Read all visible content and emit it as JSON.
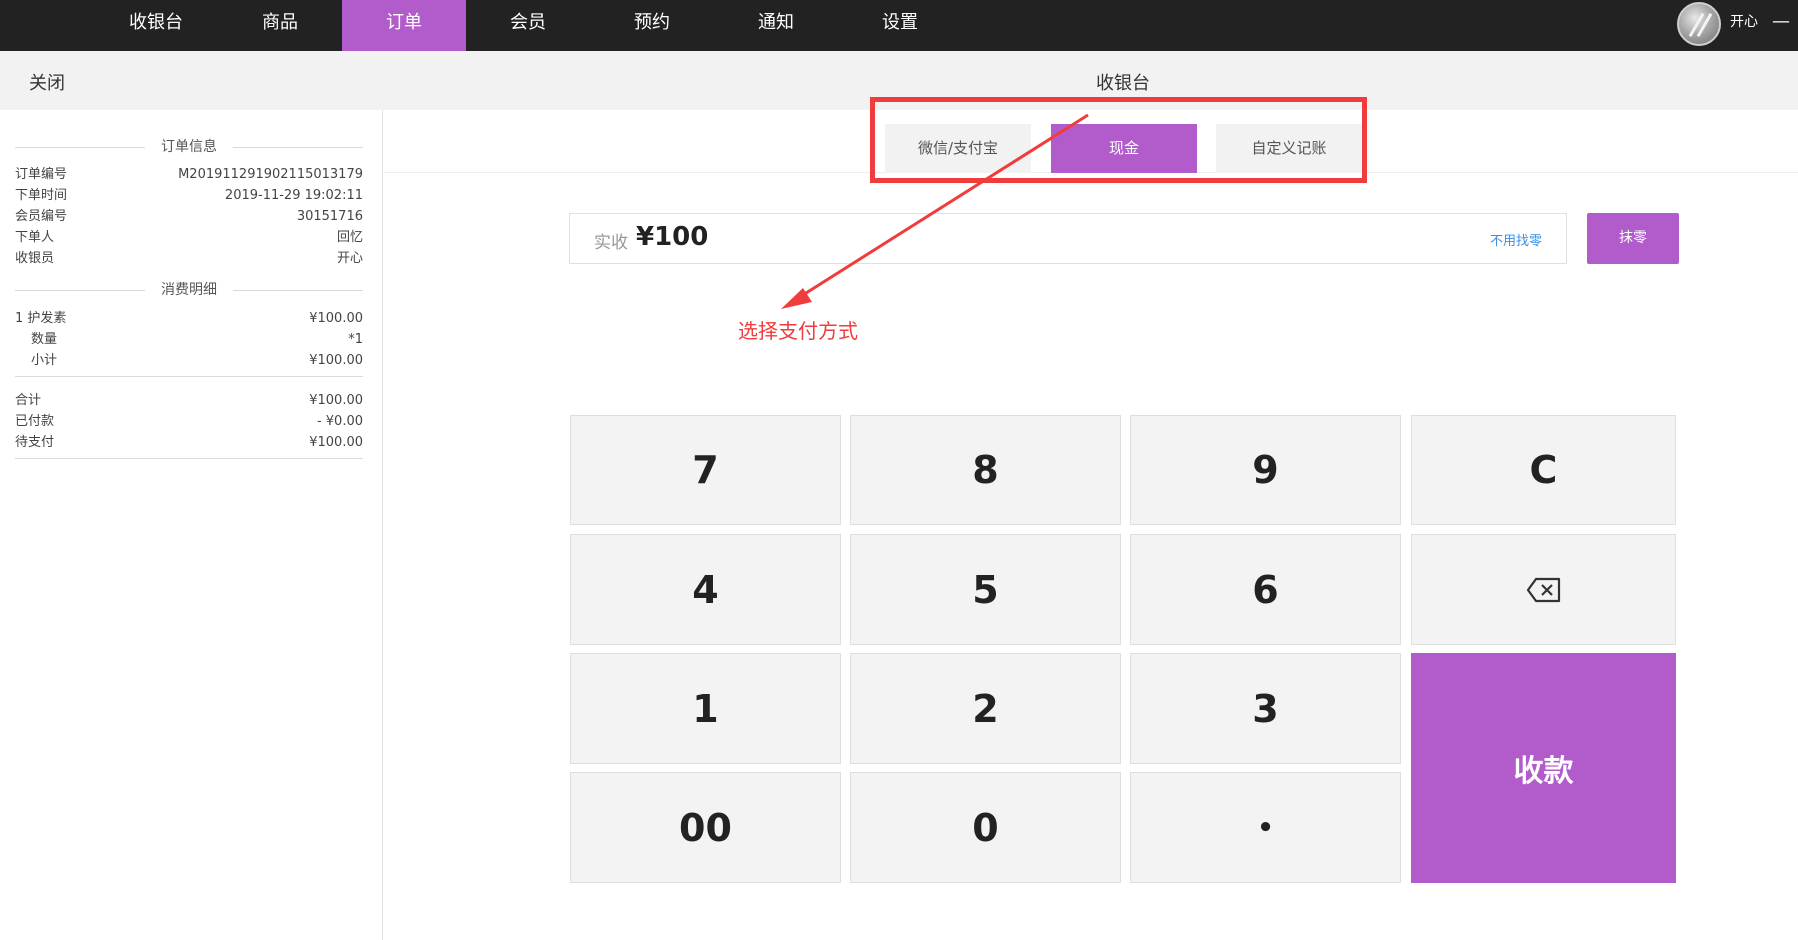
{
  "nav": {
    "items": [
      {
        "label": "收银台",
        "active": false
      },
      {
        "label": "商品",
        "active": false
      },
      {
        "label": "订单",
        "active": true
      },
      {
        "label": "会员",
        "active": false
      },
      {
        "label": "预约",
        "active": false
      },
      {
        "label": "通知",
        "active": false
      },
      {
        "label": "设置",
        "active": false
      }
    ],
    "username": "开心",
    "collapse_symbol": "—",
    "avatar_icon": "avatar-icon"
  },
  "subheader": {
    "close_label": "关闭",
    "title": "收银台"
  },
  "order_info": {
    "section_title": "订单信息",
    "rows": [
      {
        "key": "订单编号",
        "value": "M201911291902115013179"
      },
      {
        "key": "下单时间",
        "value": "2019-11-29 19:02:11"
      },
      {
        "key": "会员编号",
        "value": "30151716"
      },
      {
        "key": "下单人",
        "value": "回忆"
      },
      {
        "key": "收银员",
        "value": "开心"
      }
    ]
  },
  "consumption": {
    "section_title": "消费明细",
    "item": {
      "index_name": "1  护发素",
      "price": "¥100.00"
    },
    "qty": {
      "key": "数量",
      "value": "*1"
    },
    "subtotal": {
      "key": "小计",
      "value": "¥100.00"
    },
    "totals": [
      {
        "key": "合计",
        "value": "¥100.00"
      },
      {
        "key": "已付款",
        "value": "- ¥0.00"
      },
      {
        "key": "待支付",
        "value": "¥100.00"
      }
    ]
  },
  "payment": {
    "tabs": [
      {
        "label": "微信/支付宝",
        "active": false
      },
      {
        "label": "现金",
        "active": true
      },
      {
        "label": "自定义记账",
        "active": false
      }
    ],
    "amount_label": "实收",
    "amount_value": "¥100",
    "no_change_label": "不用找零",
    "round_off_label": "抹零"
  },
  "annotation": {
    "text": "选择支付方式",
    "color": "#f03c3c"
  },
  "keypad": {
    "keys": [
      "7",
      "8",
      "9",
      "C",
      "4",
      "5",
      "6",
      "4",
      "1",
      "2",
      "3",
      "00",
      "0",
      "•"
    ],
    "clear": "C",
    "backspace_icon": "backspace-icon",
    "pay_label": "收款"
  },
  "colors": {
    "accent": "#b25ccc",
    "nav_bg": "#222222",
    "annotation": "#f03c3c"
  }
}
